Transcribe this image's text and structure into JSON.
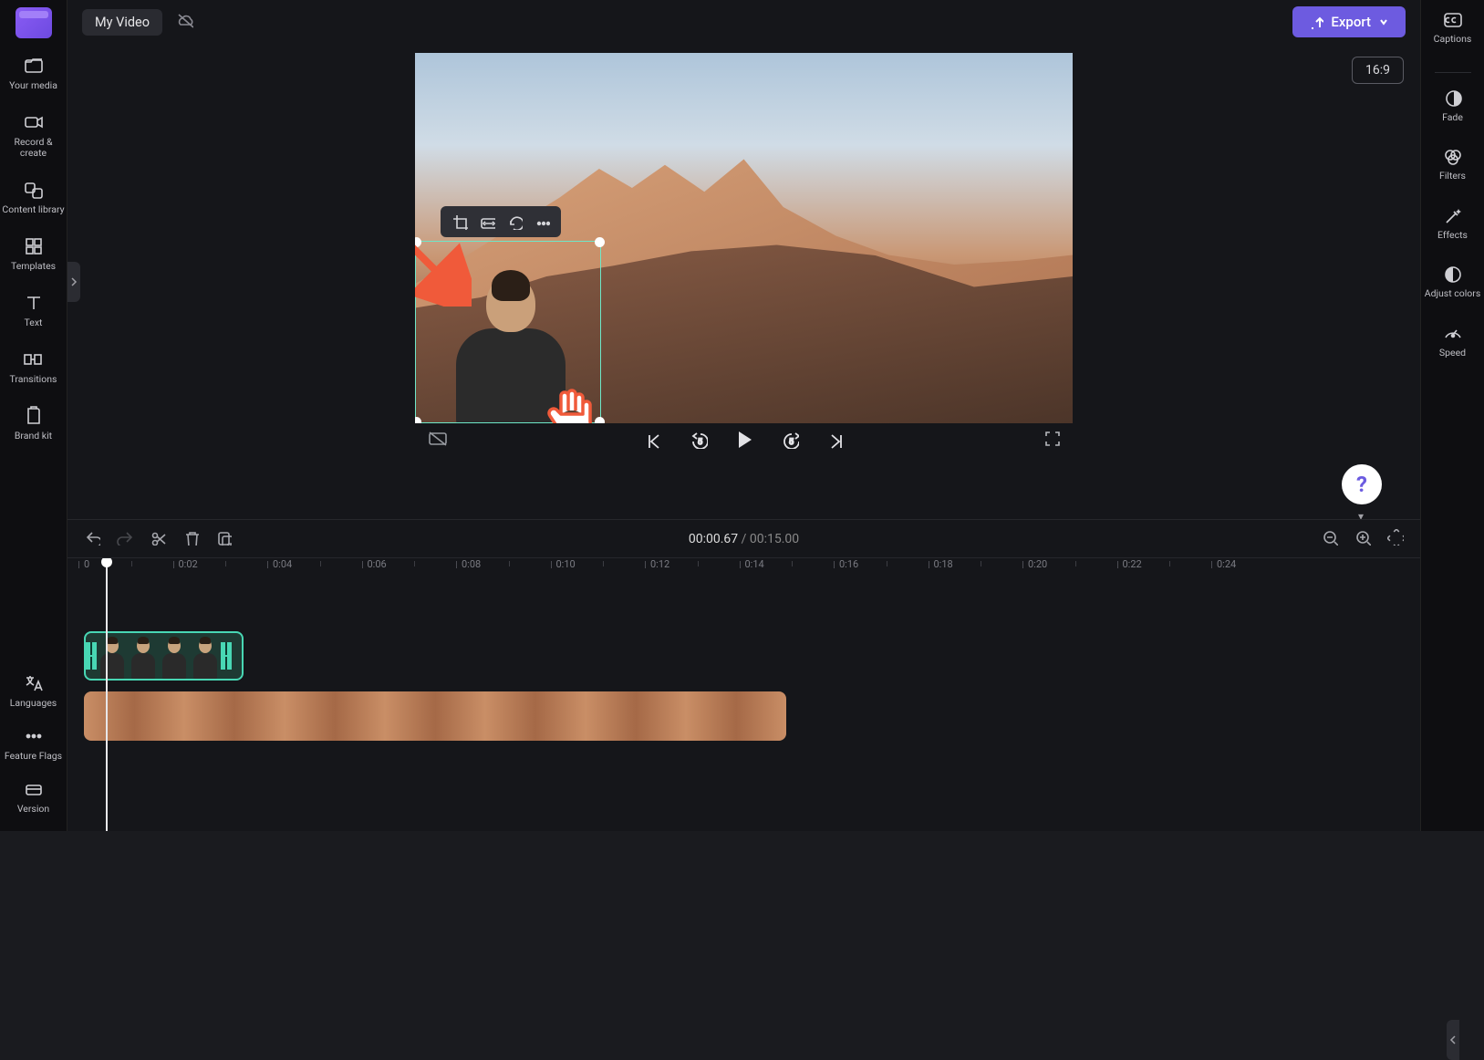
{
  "app": {
    "title": "My Video"
  },
  "topbar": {
    "export_label": "Export",
    "aspect_ratio": "16:9"
  },
  "left_sidebar": {
    "items": [
      {
        "label": "Your media",
        "icon": "folder-icon"
      },
      {
        "label": "Record & create",
        "icon": "camera-icon"
      },
      {
        "label": "Content library",
        "icon": "library-icon"
      },
      {
        "label": "Templates",
        "icon": "templates-icon"
      },
      {
        "label": "Text",
        "icon": "text-icon"
      },
      {
        "label": "Transitions",
        "icon": "transitions-icon"
      },
      {
        "label": "Brand kit",
        "icon": "brandkit-icon"
      }
    ],
    "bottom_items": [
      {
        "label": "Languages",
        "icon": "languages-icon"
      },
      {
        "label": "Feature Flags",
        "icon": "more-icon"
      },
      {
        "label": "Version",
        "icon": "version-icon"
      }
    ]
  },
  "right_sidebar": {
    "items": [
      {
        "label": "Captions",
        "icon": "captions-icon"
      },
      {
        "label": "Fade",
        "icon": "fade-icon"
      },
      {
        "label": "Filters",
        "icon": "filters-icon"
      },
      {
        "label": "Effects",
        "icon": "effects-icon"
      },
      {
        "label": "Adjust colors",
        "icon": "adjust-colors-icon"
      },
      {
        "label": "Speed",
        "icon": "speed-icon"
      }
    ]
  },
  "selection_toolbar": {
    "items": [
      "crop",
      "fit",
      "rotate",
      "more"
    ]
  },
  "playback": {
    "current_time": "00:00.67",
    "duration": "00:15.00",
    "skip_seconds": "5"
  },
  "timeline": {
    "ruler_marks": [
      "0",
      "0:02",
      "0:04",
      "0:06",
      "0:08",
      "0:10",
      "0:12",
      "0:14",
      "0:16",
      "0:18",
      "0:20",
      "0:22",
      "0:24"
    ],
    "clips": [
      {
        "id": "avatar-clip",
        "track": 0,
        "selected": true
      },
      {
        "id": "landscape-clip",
        "track": 1,
        "selected": false
      }
    ]
  },
  "colors": {
    "accent": "#6d5be0",
    "selection": "#48d7b4",
    "annotation": "#f05a3a"
  }
}
